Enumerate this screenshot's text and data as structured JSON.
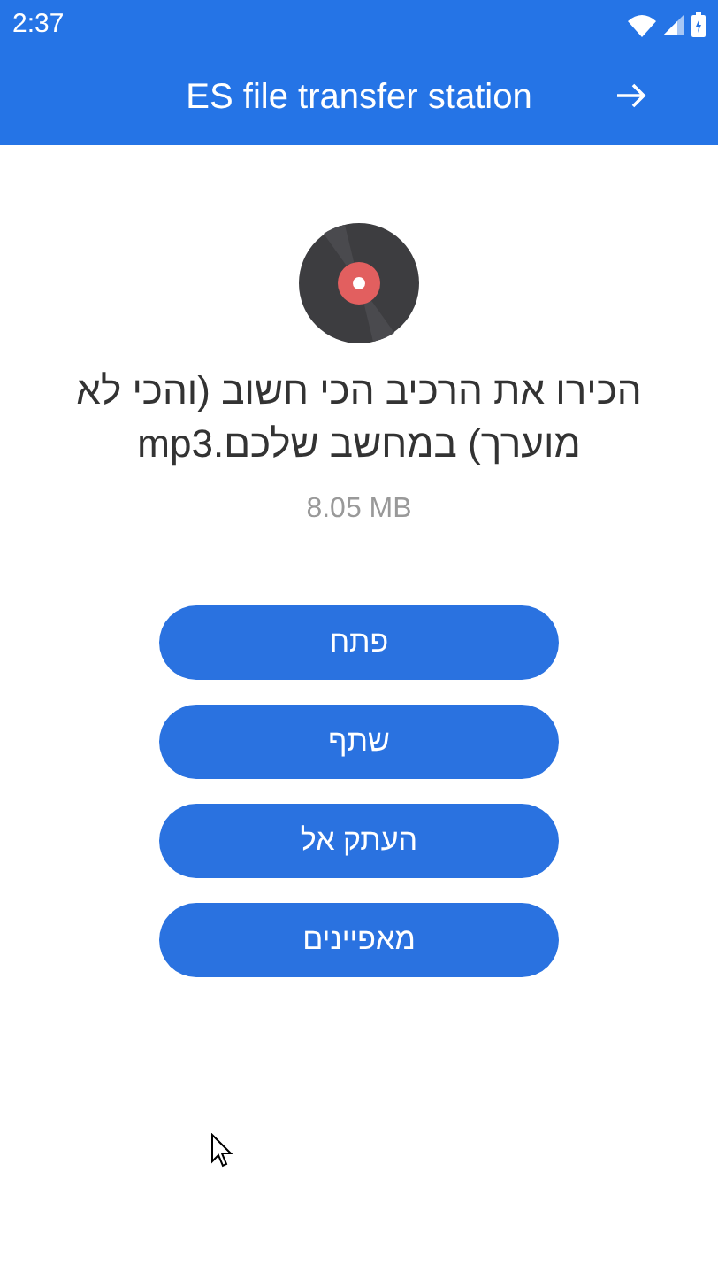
{
  "status_bar": {
    "time": "2:37"
  },
  "app_bar": {
    "title": "ES file transfer station"
  },
  "file": {
    "name": "הכירו את הרכיב הכי חשוב (והכי לא מוערך) במחשב שלכם.mp3",
    "size": "8.05 MB"
  },
  "buttons": [
    "פתח",
    "שתף",
    "העתק אל",
    "מאפיינים"
  ]
}
